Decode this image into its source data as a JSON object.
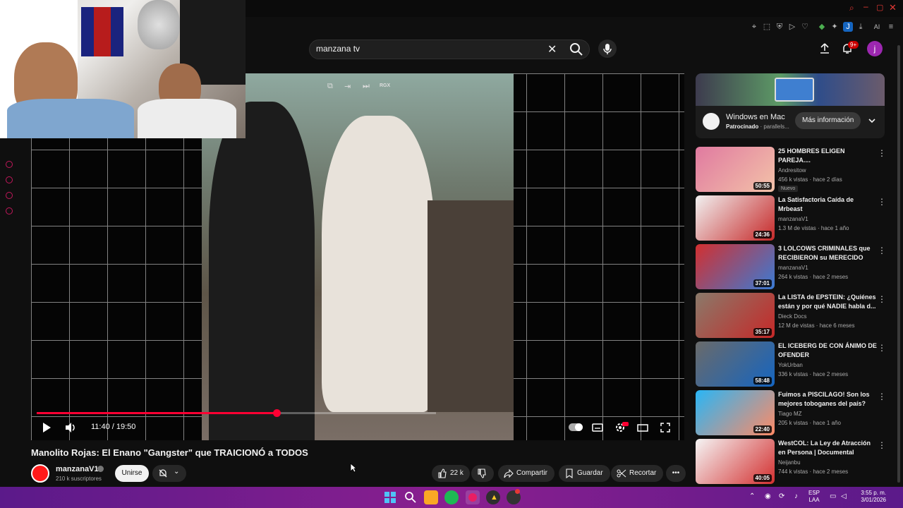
{
  "search": {
    "query": "manzana tv"
  },
  "header": {
    "notif_count": "9+",
    "avatar_letter": "j"
  },
  "player": {
    "time": "11:40 / 19:50",
    "progress": 0.6,
    "overlay_tag": "RGX"
  },
  "video": {
    "title": "Manolito Rojas: El Enano \"Gangster\" que TRAICIONÓ a TODOS",
    "channel": "manzanaV1",
    "subscribers": "210 k suscriptores",
    "join_label": "Unirse",
    "likes": "22 k",
    "share_label": "Compartir",
    "save_label": "Guardar",
    "clip_label": "Recortar"
  },
  "ad": {
    "title": "Windows en Mac",
    "sponsored": "Patrocinado",
    "advertiser": "parallels...",
    "button": "Más información"
  },
  "recommendations": [
    {
      "title": "25 HOMBRES ELIGEN PAREJA....",
      "channel": "Andresitow",
      "meta": "456 k vistas · hace 2 días",
      "duration": "50:55",
      "badge": "Nuevo",
      "thumb_colors": [
        "#e07aa0",
        "#f3c2a8"
      ]
    },
    {
      "title": "La Satisfactoria Caída de Mrbeast",
      "channel": "manzanaV1",
      "meta": "1.3 M de vistas · hace 1 año",
      "duration": "24:36",
      "badge": "",
      "thumb_colors": [
        "#f1f1f1",
        "#c62828"
      ]
    },
    {
      "title": "3 LOLCOWS CRIMINALES que RECIBIERON su MERECIDO",
      "channel": "manzanaV1",
      "meta": "264 k vistas · hace 2 meses",
      "duration": "37:01",
      "badge": "",
      "thumb_colors": [
        "#d32f2f",
        "#3a7bd5"
      ]
    },
    {
      "title": "La LISTA de EPSTEIN: ¿Quiénes están y por qué NADIE habla d...",
      "channel": "Dieck Docs",
      "meta": "12 M de vistas · hace 6 meses",
      "duration": "35:17",
      "badge": "",
      "thumb_colors": [
        "#8a7a6a",
        "#c62828"
      ]
    },
    {
      "title": "EL ICEBERG DE CON ÁNIMO DE OFENDER",
      "channel": "YokUrban",
      "meta": "336 k vistas · hace 2 meses",
      "duration": "58:48",
      "badge": "",
      "thumb_colors": [
        "#6a6a6a",
        "#1565c0"
      ]
    },
    {
      "title": "Fuimos a PISCILAGO! Son los mejores toboganes del país?",
      "channel": "Tiago MZ",
      "meta": "205 k vistas · hace 1 año",
      "duration": "22:40",
      "badge": "",
      "thumb_colors": [
        "#29b6f6",
        "#ff8a65"
      ]
    },
    {
      "title": "WestCOL: La Ley de Atracción en Persona | Documental",
      "channel": "Neijanbu",
      "meta": "744 k vistas · hace 2 meses",
      "duration": "40:05",
      "badge": "",
      "thumb_colors": [
        "#f5f5f5",
        "#d32f2f"
      ]
    }
  ],
  "taskbar": {
    "lang_line1": "ESP",
    "lang_line2": "LAA",
    "time": "3:55 p. m.",
    "date": "3/01/2026"
  },
  "colors": {
    "accent": "#ff0033",
    "taskbar": "#8a1f8f",
    "avatar": "#9c27b0"
  }
}
